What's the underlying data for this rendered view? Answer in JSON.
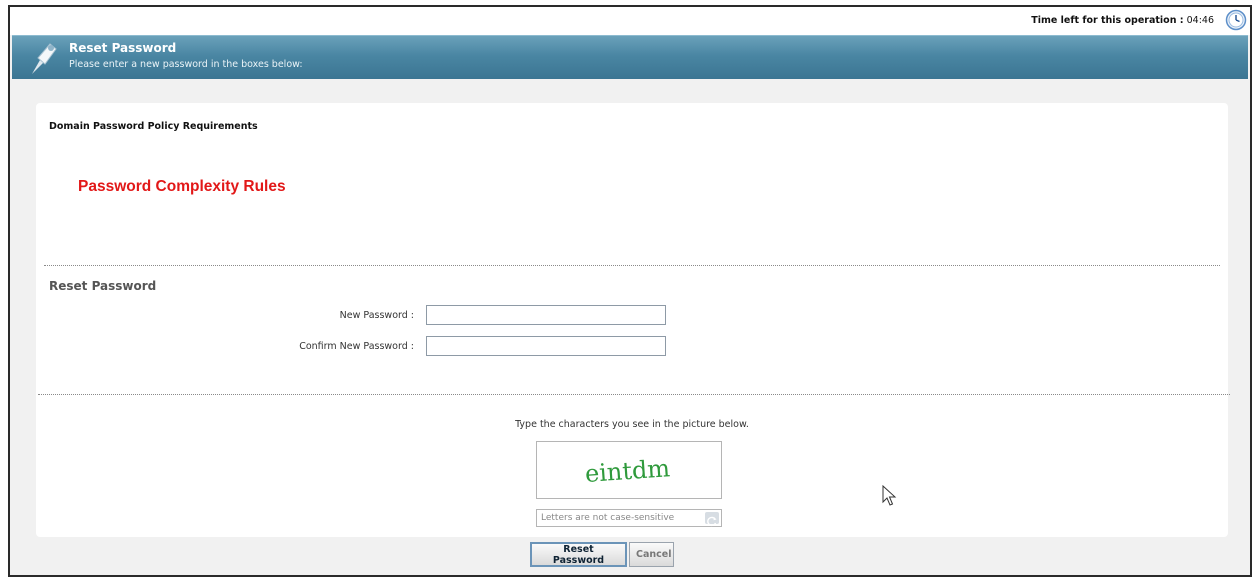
{
  "header": {
    "timer_label": "Time left for this operation :",
    "timer_value": "04:46"
  },
  "banner": {
    "title": "Reset Password",
    "subtitle": "Please enter a new password in the boxes below:"
  },
  "policy": {
    "title": "Domain Password Policy Requirements",
    "complexity_text": "Password Complexity Rules"
  },
  "reset_form": {
    "section_title": "Reset Password",
    "new_password_label": "New Password :",
    "new_password_value": "",
    "confirm_password_label": "Confirm New Password :",
    "confirm_password_value": ""
  },
  "captcha": {
    "instruction": "Type the characters you see in the picture below.",
    "image_text": "eintdm",
    "input_placeholder": "Letters are not case-sensitive"
  },
  "buttons": {
    "reset_label": "Reset Password",
    "cancel_label": "Cancel"
  },
  "colors": {
    "banner": "#4a86a3",
    "complexity_text": "#e21818",
    "captcha_text": "#2f9a3c"
  },
  "icons": [
    "clock-icon",
    "key-banner-icon",
    "refresh-icon",
    "mouse-pointer-icon"
  ]
}
